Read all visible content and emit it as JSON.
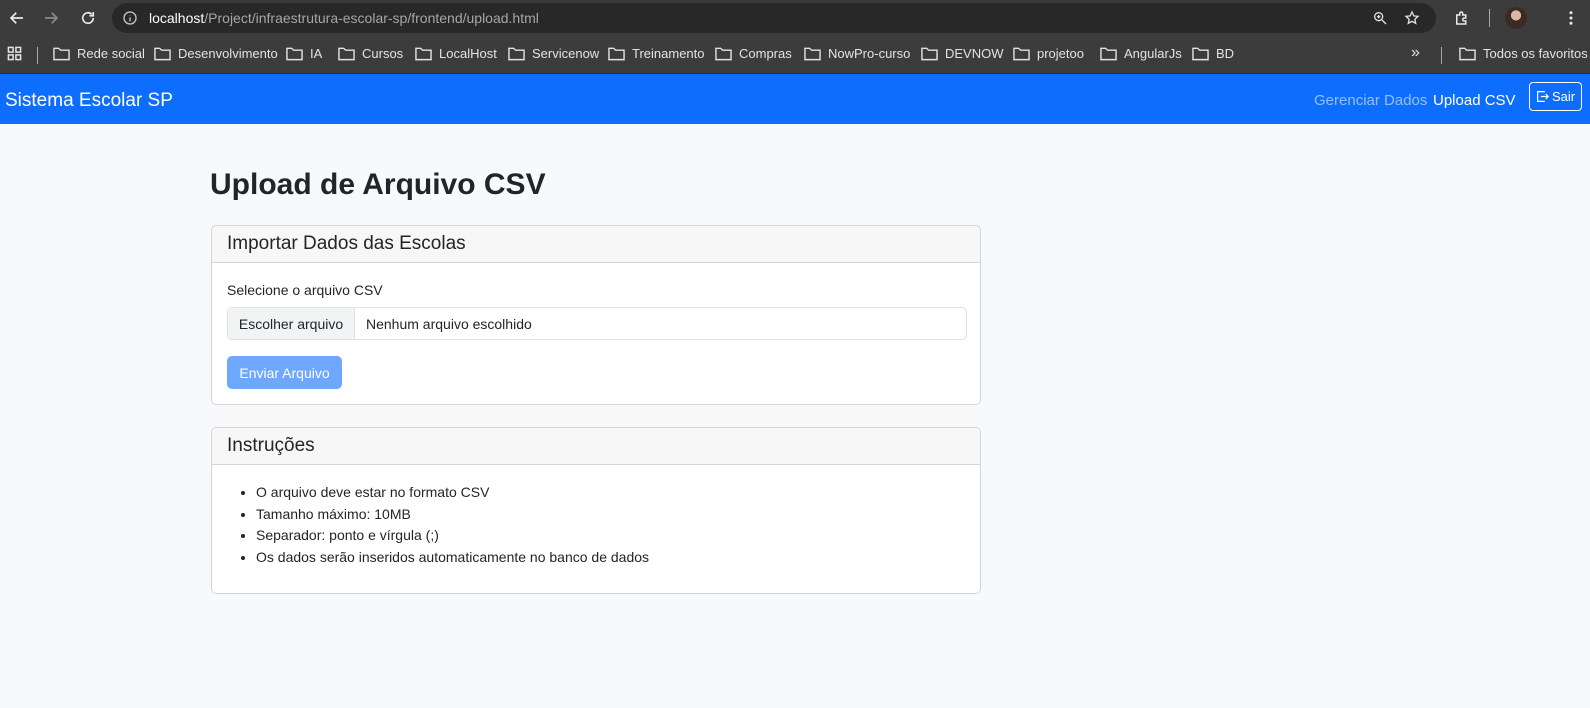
{
  "browser": {
    "url_host": "localhost",
    "url_path": "/Project/infraestrutura-escolar-sp/frontend/upload.html",
    "bookmarks": [
      "Rede social",
      "Desenvolvimento",
      "IA",
      "Cursos",
      "LocalHost",
      "Servicenow",
      "Treinamento",
      "Compras",
      "NowPro-curso",
      "DEVNOW",
      "projetoo",
      "AngularJs",
      "BD"
    ],
    "more_bookmarks": "»",
    "all_bookmarks": "Todos os favoritos"
  },
  "navbar": {
    "brand": "Sistema Escolar SP",
    "links": [
      "Gerenciar Dados",
      "Upload CSV"
    ],
    "logout_label": "Sair",
    "color": "#0d6efd"
  },
  "page": {
    "title": "Upload de Arquivo CSV"
  },
  "upload_card": {
    "header": "Importar Dados das Escolas",
    "field_label": "Selecione o arquivo CSV",
    "file_button": "Escolher arquivo",
    "file_status": "Nenhum arquivo escolhido",
    "submit_label": "Enviar Arquivo"
  },
  "instructions_card": {
    "header": "Instruções",
    "items": [
      "O arquivo deve estar no formato CSV",
      "Tamanho máximo: 10MB",
      "Separador: ponto e vírgula (;)",
      "Os dados serão inseridos automaticamente no banco de dados"
    ]
  }
}
